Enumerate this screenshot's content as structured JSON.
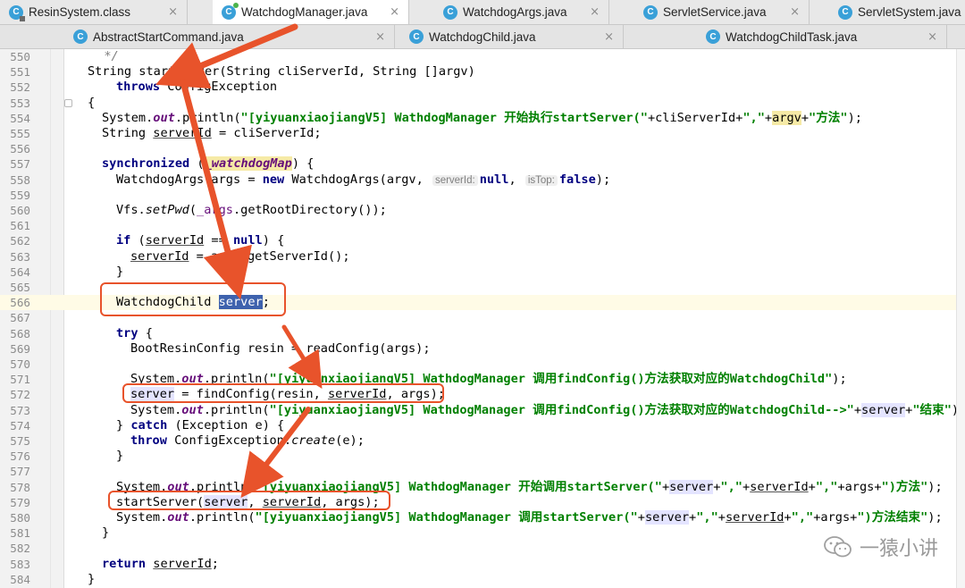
{
  "tabs_row1": [
    {
      "label": "ResinSystem.class",
      "icon": "class-icon"
    },
    {
      "label": "WatchdogManager.java",
      "icon": "class-icon",
      "active": true
    },
    {
      "label": "WatchdogArgs.java",
      "icon": "class-icon"
    },
    {
      "label": "ServletService.java",
      "icon": "class-icon"
    },
    {
      "label": "ServletSystem.java",
      "icon": "class-icon"
    }
  ],
  "tabs_row2": [
    {
      "label": "AbstractStartCommand.java",
      "icon": "class-icon"
    },
    {
      "label": "WatchdogChild.java",
      "icon": "class-icon"
    },
    {
      "label": "WatchdogChildTask.java",
      "icon": "class-icon"
    }
  ],
  "tab_close_glyph": "×",
  "line_numbers": [
    "550",
    "551",
    "552",
    "553",
    "554",
    "555",
    "556",
    "557",
    "558",
    "559",
    "560",
    "561",
    "562",
    "563",
    "564",
    "565",
    "566",
    "567",
    "568",
    "569",
    "570",
    "571",
    "572",
    "573",
    "574",
    "575",
    "576",
    "577",
    "578",
    "579",
    "580",
    "581",
    "582",
    "583",
    "584"
  ],
  "code": {
    "l550": "  */",
    "l551": "String startServer(String cliServerId, String []argv)",
    "l552a": "throws",
    "l552b": " ConfigException",
    "l553": "{",
    "l554a": "System.",
    "l554b": "out",
    "l554c": ".println(",
    "l554d": "\"[yiyuanxiaojiangV5] WathdogManager 开始执行startServer(\"",
    "l554e": "+cliServerId+",
    "l554f": "\",\"",
    "l554g": "+",
    "l554h": "argv",
    "l554i": "+",
    "l554j": "\"方法\"",
    "l554k": ");",
    "l555a": "String ",
    "l555b": "serverId",
    "l555c": " = cliServerId;",
    "l557a": "synchronized",
    "l557b": " (",
    "l557c": "_watchdogMap",
    "l557d": ") {",
    "l558a": "WatchdogArgs args = ",
    "l558b": "new",
    "l558c": " WatchdogArgs(argv, ",
    "l558h1": "serverId:",
    "l558d": "null",
    "l558e": ", ",
    "l558h2": "isTop:",
    "l558f": "false",
    "l558g": ");",
    "l560a": "Vfs.",
    "l560b": "setPwd",
    "l560c": "(",
    "l560d": "_args",
    "l560e": ".getRootDirectory());",
    "l562a": "if",
    "l562b": " (",
    "l562c": "serverId",
    "l562d": " == ",
    "l562e": "null",
    "l562f": ") {",
    "l563a": "serverId",
    "l563b": " = args.getServerId();",
    "l564": "}",
    "l566a": "WatchdogChild ",
    "l566b": "server",
    "l566c": ";",
    "l568a": "try",
    "l568b": " {",
    "l569": "BootResinConfig resin = readConfig(args);",
    "l571a": "System.",
    "l571b": "out",
    "l571c": ".println(",
    "l571d": "\"[yiyuanxiaojiangV5] WathdogManager 调用findConfig()方法获取对应的WatchdogChild\"",
    "l571e": ");",
    "l572a": "server",
    "l572b": " = findConfig(resin, ",
    "l572c": "serverId",
    "l572d": ", args);",
    "l573a": "System.",
    "l573b": "out",
    "l573c": ".println(",
    "l573d": "\"[yiyuanxiaojiangV5] WathdogManager 调用findConfig()方法获取对应的WatchdogChild-->\"",
    "l573e": "+",
    "l573f": "server",
    "l573g": "+",
    "l573h": "\"结束\"",
    "l573i": ");",
    "l574a": "} ",
    "l574b": "catch",
    "l574c": " (Exception e) {",
    "l575a": "throw",
    "l575b": " ConfigException.",
    "l575c": "create",
    "l575d": "(e);",
    "l576": "}",
    "l578a": "System.",
    "l578b": "out",
    "l578c": ".println(",
    "l578d": "\"[yiyuanxiaojiangV5] WathdogManager 开始调用startServer(\"",
    "l578e": "+",
    "l578f": "server",
    "l578g": "+",
    "l578h": "\",\"",
    "l578i": "+",
    "l578j": "serverId",
    "l578k": "+",
    "l578l": "\",\"",
    "l578m": "+args+",
    "l578n": "\")方法\"",
    "l578o": ");",
    "l579a": "startServer(",
    "l579b": "server",
    "l579c": ", ",
    "l579d": "serverId",
    "l579e": ", args);",
    "l580a": "System.",
    "l580b": "out",
    "l580c": ".println(",
    "l580d": "\"[yiyuanxiaojiangV5] WathdogManager 调用startServer(\"",
    "l580e": "+",
    "l580f": "server",
    "l580g": "+",
    "l580h": "\",\"",
    "l580i": "+",
    "l580j": "serverId",
    "l580k": "+",
    "l580l": "\",\"",
    "l580m": "+args+",
    "l580n": "\")方法结束\"",
    "l580o": ");",
    "l581": "}",
    "l583a": "return",
    "l583b": " ",
    "l583c": "serverId",
    "l583d": ";",
    "l584": "}"
  },
  "watermark": "一猿小讲",
  "colors": {
    "keyword": "#000080",
    "string": "#008000",
    "field": "#660e7a",
    "annotation": "#e8532b",
    "selection": "#3e62ad"
  }
}
